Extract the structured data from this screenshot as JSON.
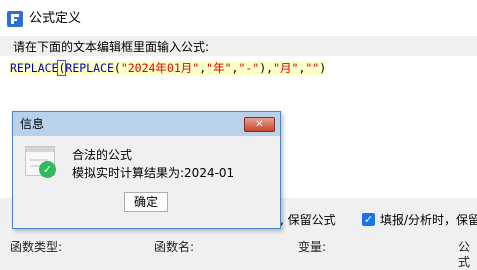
{
  "window": {
    "title": "公式定义"
  },
  "editor": {
    "instruction": "请在下面的文本编辑框里面输入公式:",
    "formula": {
      "p1": "REPLACE",
      "p2": "(",
      "p3": "REPLACE",
      "p4": "(",
      "p5": "\"2024年01月\"",
      "p6": ",",
      "p7": "\"年\"",
      "p8": ",",
      "p9": "\"-\"",
      "p10": "),",
      "p11": "\"月\"",
      "p12": ",",
      "p13": "\"\"",
      "p14": ")"
    }
  },
  "options": {
    "option1_visible": "时, 保留公式",
    "option2": "填报/分析时，保留",
    "option2_checked": true
  },
  "columns": [
    "函数类型:",
    "函数名:",
    "变量:",
    "公式"
  ],
  "dialog": {
    "title": "信息",
    "close_glyph": "✕",
    "message": "合法的公式",
    "result": "模拟实时计算结果为:2024-01",
    "ok_label": "确定"
  }
}
